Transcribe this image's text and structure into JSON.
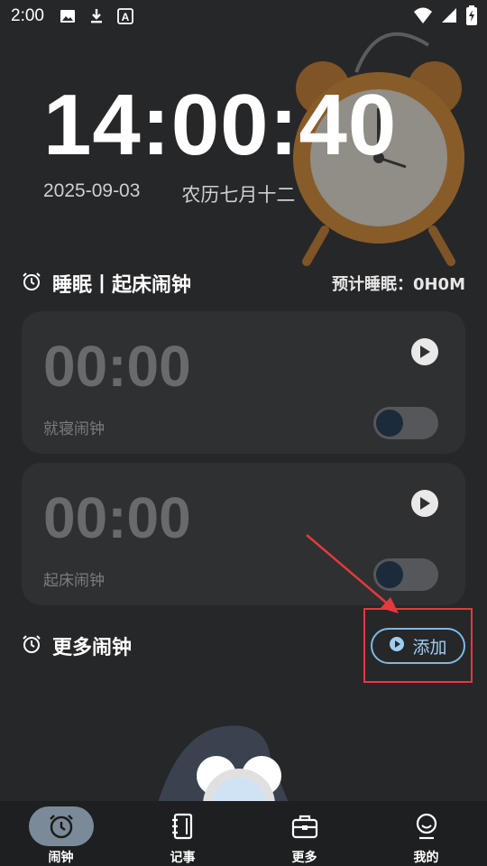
{
  "status_bar": {
    "time": "2:00",
    "icons": [
      "image-icon",
      "download-icon",
      "a-icon"
    ],
    "right_icons": [
      "wifi-icon",
      "signal-icon",
      "battery-icon"
    ]
  },
  "clock": {
    "time": "14:00:40",
    "date": "2025-09-03",
    "lunar": "农历七月十二"
  },
  "sleep_section": {
    "title": "睡眠丨起床闹钟",
    "estimate": "预计睡眠：0H0M"
  },
  "alarms": [
    {
      "time": "00:00",
      "label": "就寝闹钟",
      "enabled": false
    },
    {
      "time": "00:00",
      "label": "起床闹钟",
      "enabled": false
    }
  ],
  "more_section": {
    "title": "更多闹钟",
    "add_label": "添加"
  },
  "tabs": [
    {
      "label": "闹钟",
      "icon": "alarm-icon",
      "active": true
    },
    {
      "label": "记事",
      "icon": "notebook-icon",
      "active": false
    },
    {
      "label": "更多",
      "icon": "toolbox-icon",
      "active": false
    },
    {
      "label": "我的",
      "icon": "profile-icon",
      "active": false
    }
  ],
  "colors": {
    "background": "#262729",
    "card": "#2f3032",
    "accent": "#7eb8e6",
    "annotation": "#e5393b"
  }
}
